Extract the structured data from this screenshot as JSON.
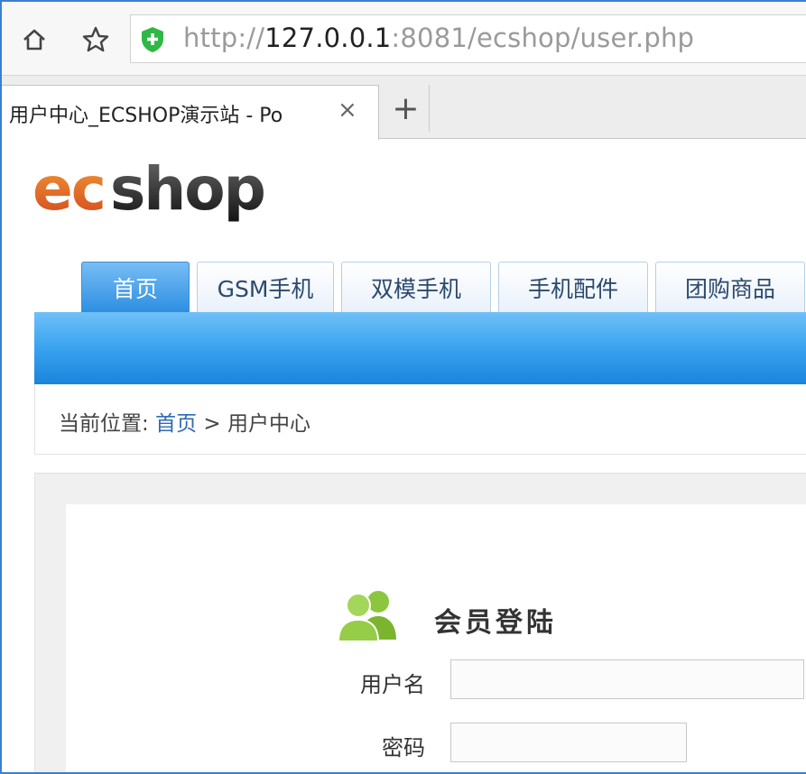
{
  "browser": {
    "url_scheme": "http://",
    "url_host": "127.0.0.1",
    "url_rest": ":8081/ecshop/user.php",
    "tab_title": "用户中心_ECSHOP演示站 - Po",
    "tab_close": "×",
    "new_tab": "+"
  },
  "site": {
    "logo_text": "ecshop",
    "nav": [
      "首页",
      "GSM手机",
      "双模手机",
      "手机配件",
      "团购商品"
    ],
    "colors": {
      "nav_active": "#2d8fe1",
      "bar": "#3aa3ef",
      "link": "#2f6ab4"
    }
  },
  "breadcrumb": {
    "prefix": "当前位置:",
    "home": "首页",
    "separator": ">",
    "current": "用户中心"
  },
  "login": {
    "title": "会员登陆",
    "username_label": "用户名",
    "password_label": "密码",
    "username_value": "",
    "password_value": ""
  },
  "icons": [
    "home-icon",
    "star-icon",
    "shield-icon",
    "close-icon",
    "plus-icon",
    "member-icon"
  ]
}
